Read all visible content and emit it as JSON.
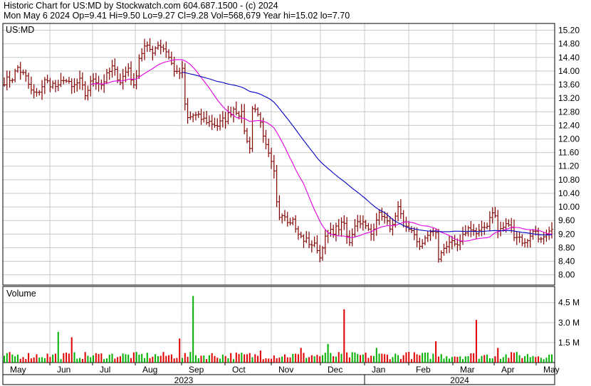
{
  "header": {
    "line1": "Historic Chart for US:MD by Stockwatch.com 604.687.1500 - (c) 2024",
    "line2": "Mon May  6 2024  Op=9.41  Hi=9.50  Lo=9.27  Cl=9.28  Vol=568,679  Year hi=15.02  lo=7.70"
  },
  "colors": {
    "price_bar": "#800000",
    "ma_short": "#e000e0",
    "ma_long": "#0000c0",
    "vol_up": "#00b000",
    "vol_down": "#e00000",
    "grid": "#c8c8c8"
  },
  "chart_data": {
    "type": "bar",
    "price_panel": {
      "label": "US:MD",
      "ylim": [
        7.7,
        15.4
      ],
      "yticks": [
        "15.20",
        "14.80",
        "14.40",
        "14.00",
        "13.60",
        "13.20",
        "12.80",
        "12.40",
        "12.00",
        "11.60",
        "11.20",
        "10.80",
        "10.40",
        "10.00",
        "9.60",
        "9.20",
        "8.80",
        "8.40",
        "8.00"
      ],
      "grid": true
    },
    "volume_panel": {
      "label": "Volume",
      "ylim": [
        0,
        5.5
      ],
      "yticks": [
        "4.5 M",
        "3.0 M",
        "1.5 M"
      ],
      "grid": true
    },
    "x_months": [
      "May",
      "Jun",
      "Jul",
      "Aug",
      "Sep",
      "Oct",
      "Nov",
      "Dec",
      "Jan",
      "Feb",
      "Mar",
      "Apr",
      "May"
    ],
    "x_years": [
      "2023",
      "2024"
    ],
    "price_anchors": [
      [
        0,
        13.7
      ],
      [
        3,
        13.8
      ],
      [
        5,
        14.1
      ],
      [
        8,
        13.8
      ],
      [
        10,
        13.4
      ],
      [
        12,
        13.3
      ],
      [
        15,
        13.7
      ],
      [
        18,
        13.6
      ],
      [
        20,
        13.5
      ],
      [
        22,
        13.8
      ],
      [
        25,
        13.5
      ],
      [
        28,
        13.7
      ],
      [
        30,
        13.3
      ],
      [
        33,
        13.8
      ],
      [
        36,
        13.6
      ],
      [
        40,
        14.1
      ],
      [
        43,
        13.7
      ],
      [
        46,
        14.1
      ],
      [
        48,
        13.5
      ],
      [
        50,
        14.4
      ],
      [
        52,
        14.7
      ],
      [
        55,
        14.6
      ],
      [
        57,
        14.8
      ],
      [
        60,
        14.6
      ],
      [
        62,
        14.2
      ],
      [
        64,
        13.9
      ],
      [
        66,
        14.0
      ],
      [
        67,
        13.0
      ],
      [
        68,
        12.6
      ],
      [
        70,
        12.7
      ],
      [
        73,
        12.6
      ],
      [
        76,
        12.5
      ],
      [
        79,
        12.4
      ],
      [
        82,
        12.6
      ],
      [
        85,
        12.9
      ],
      [
        88,
        12.7
      ],
      [
        89,
        12.3
      ],
      [
        90,
        11.9
      ],
      [
        91,
        11.8
      ],
      [
        92,
        12.9
      ],
      [
        94,
        12.8
      ],
      [
        96,
        12.0
      ],
      [
        98,
        11.5
      ],
      [
        100,
        11.0
      ],
      [
        101,
        10.2
      ],
      [
        102,
        9.8
      ],
      [
        104,
        9.8
      ],
      [
        106,
        9.5
      ],
      [
        107,
        9.7
      ],
      [
        108,
        9.3
      ],
      [
        110,
        9.1
      ],
      [
        112,
        9.0
      ],
      [
        114,
        8.9
      ],
      [
        116,
        8.8
      ],
      [
        117,
        8.5
      ],
      [
        118,
        8.9
      ],
      [
        120,
        9.2
      ],
      [
        122,
        9.3
      ],
      [
        124,
        9.4
      ],
      [
        126,
        9.5
      ],
      [
        127,
        9.1
      ],
      [
        128,
        9.0
      ],
      [
        130,
        9.5
      ],
      [
        132,
        9.6
      ],
      [
        134,
        9.4
      ],
      [
        136,
        9.2
      ],
      [
        138,
        9.7
      ],
      [
        140,
        9.8
      ],
      [
        142,
        9.5
      ],
      [
        144,
        9.4
      ],
      [
        146,
        9.9
      ],
      [
        148,
        9.5
      ],
      [
        150,
        9.4
      ],
      [
        152,
        9.1
      ],
      [
        154,
        8.9
      ],
      [
        156,
        9.0
      ],
      [
        158,
        9.3
      ],
      [
        160,
        9.2
      ],
      [
        161,
        8.5
      ],
      [
        162,
        8.6
      ],
      [
        163,
        8.8
      ],
      [
        165,
        9.0
      ],
      [
        167,
        8.8
      ],
      [
        169,
        8.9
      ],
      [
        171,
        9.3
      ],
      [
        173,
        9.4
      ],
      [
        175,
        9.2
      ],
      [
        177,
        9.3
      ],
      [
        179,
        9.5
      ],
      [
        181,
        9.9
      ],
      [
        182,
        9.7
      ],
      [
        183,
        9.3
      ],
      [
        185,
        9.4
      ],
      [
        187,
        9.5
      ],
      [
        189,
        9.2
      ],
      [
        191,
        9.1
      ],
      [
        193,
        8.9
      ],
      [
        195,
        9.2
      ],
      [
        197,
        9.3
      ],
      [
        199,
        9.0
      ],
      [
        201,
        9.1
      ],
      [
        203,
        9.3
      ]
    ],
    "volume_spikes": [
      [
        20,
        2.3
      ],
      [
        25,
        1.9
      ],
      [
        65,
        1.8
      ],
      [
        70,
        5.0
      ],
      [
        95,
        0.9
      ],
      [
        110,
        1.1
      ],
      [
        120,
        1.4
      ],
      [
        126,
        4.0
      ],
      [
        138,
        1.1
      ],
      [
        150,
        0.8
      ],
      [
        160,
        1.6
      ],
      [
        175,
        3.2
      ],
      [
        183,
        1.1
      ],
      [
        190,
        0.8
      ]
    ]
  }
}
